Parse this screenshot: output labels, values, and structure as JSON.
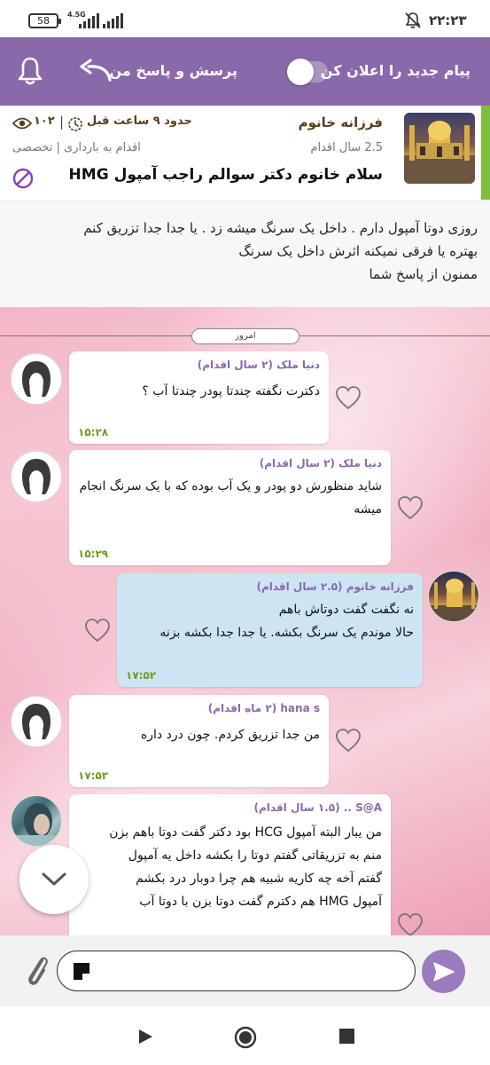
{
  "status": {
    "battery": "58",
    "network": "4.5G",
    "time": "۲۲:۲۳"
  },
  "toolbar": {
    "notify_label": "پیام جدید را اعلان کن",
    "notify_enabled": false,
    "title": "پرسش و پاسخ من"
  },
  "question": {
    "author": "فرزانه خانوم",
    "author_meta": "2.5 سال اقدام",
    "time_ago": "حدود ۹ ساعت قبل",
    "views": "۱۰۲",
    "category": "اقدام به بارداری | تخصصی",
    "title": "سلام خانوم دکتر سوالم راجب آمپول HMG",
    "body": [
      "روزی دوتا آمپول دارم . داخل یک سرنگ میشه زد . یا جدا جدا تزریق کنم",
      "بهتره یا فرقی نمیکنه اثرش داخل یک سرنگ",
      "ممنون از پاسخ شما"
    ]
  },
  "chat": {
    "day_label": "امروز",
    "messages": [
      {
        "sender": "دنیا ملک (۲ سال اقدام)",
        "text": "دکترت نگفته چندتا پودر چندتا آب ؟",
        "time": "۱۵:۲۸"
      },
      {
        "sender": "دنیا ملک (۲ سال اقدام)",
        "text": "شاید منظورش دو پودر و یک آب بوده که با یک سرنگ انجام میشه",
        "time": "۱۵:۲۹"
      },
      {
        "sender": "فرزانه خانوم (۲.۵ سال اقدام)",
        "text": "نه نگفت گفت دوتاش باهم\nحالا موندم یک سرنگ بکشه. یا جدا جدا بکشه بزنه",
        "time": "۱۷:۵۲"
      },
      {
        "sender": "hana s (۲ ماه اقدام)",
        "text": "من جدا تزریق کردم. چون درد داره",
        "time": "۱۷:۵۳"
      },
      {
        "sender": "S@A .. (۱.۵ سال اقدام)",
        "text": "من یبار  البته آمپول HCG بود دکتر گفت دوتا باهم بزن\nمنم به تزریقاتی گفتم دوتا را بکشه داخل یه آمپول\nگفتم آخه چه کاریه شبیه هم چرا دوبار درد بکشم\nآمپول HMG هم دکترم گفت دوتا بزن با دوتا آب",
        "time": ""
      }
    ]
  },
  "input": {
    "placeholder": ""
  }
}
